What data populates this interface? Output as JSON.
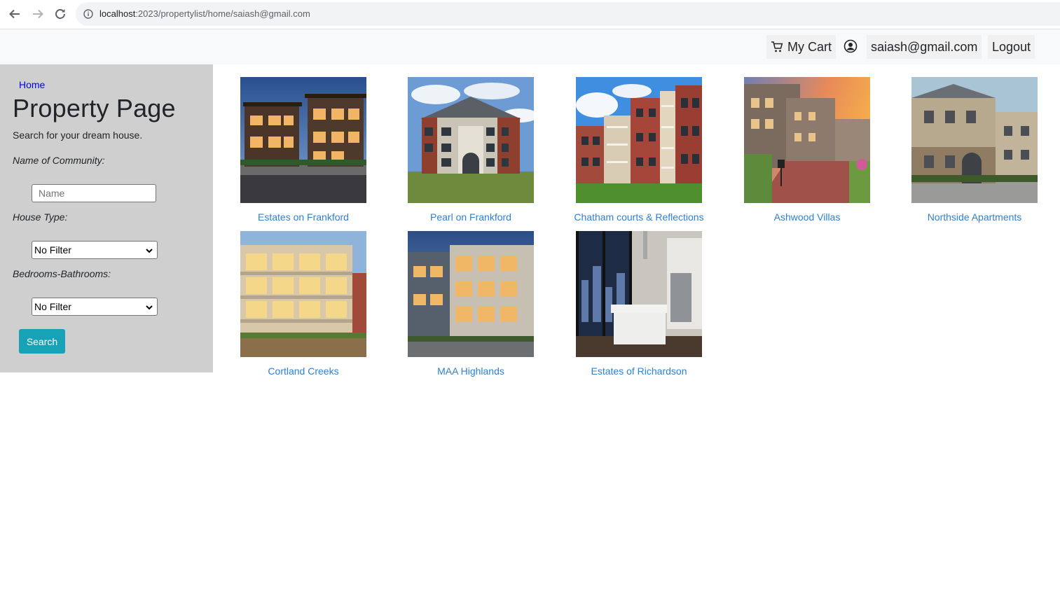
{
  "browser": {
    "url_host": "localhost",
    "url_path": ":2023/propertylist/home/saiash@gmail.com"
  },
  "topnav": {
    "cart_label": "My Cart",
    "user_email": "saiash@gmail.com",
    "logout_label": "Logout"
  },
  "sidebar": {
    "home_link": "Home",
    "title": "Property Page",
    "subtitle": "Search for your dream house.",
    "community_label": "Name of Community:",
    "community_placeholder": "Name",
    "house_type_label": "House Type:",
    "house_type_value": "No Filter",
    "bed_bath_label": "Bedrooms-Bathrooms:",
    "bed_bath_value": "No Filter",
    "search_button": "Search"
  },
  "properties": [
    {
      "name": "Estates on Frankford"
    },
    {
      "name": "Pearl on Frankford"
    },
    {
      "name": "Chatham courts & Reflections"
    },
    {
      "name": "Ashwood Villas"
    },
    {
      "name": "Northside Apartments"
    },
    {
      "name": "Cortland Creeks"
    },
    {
      "name": "MAA Highlands"
    },
    {
      "name": "Estates of Richardson"
    }
  ],
  "colors": {
    "sidebar_bg": "#cfcfcf",
    "link": "#2f80d1",
    "search_button": "#17a2b8"
  }
}
